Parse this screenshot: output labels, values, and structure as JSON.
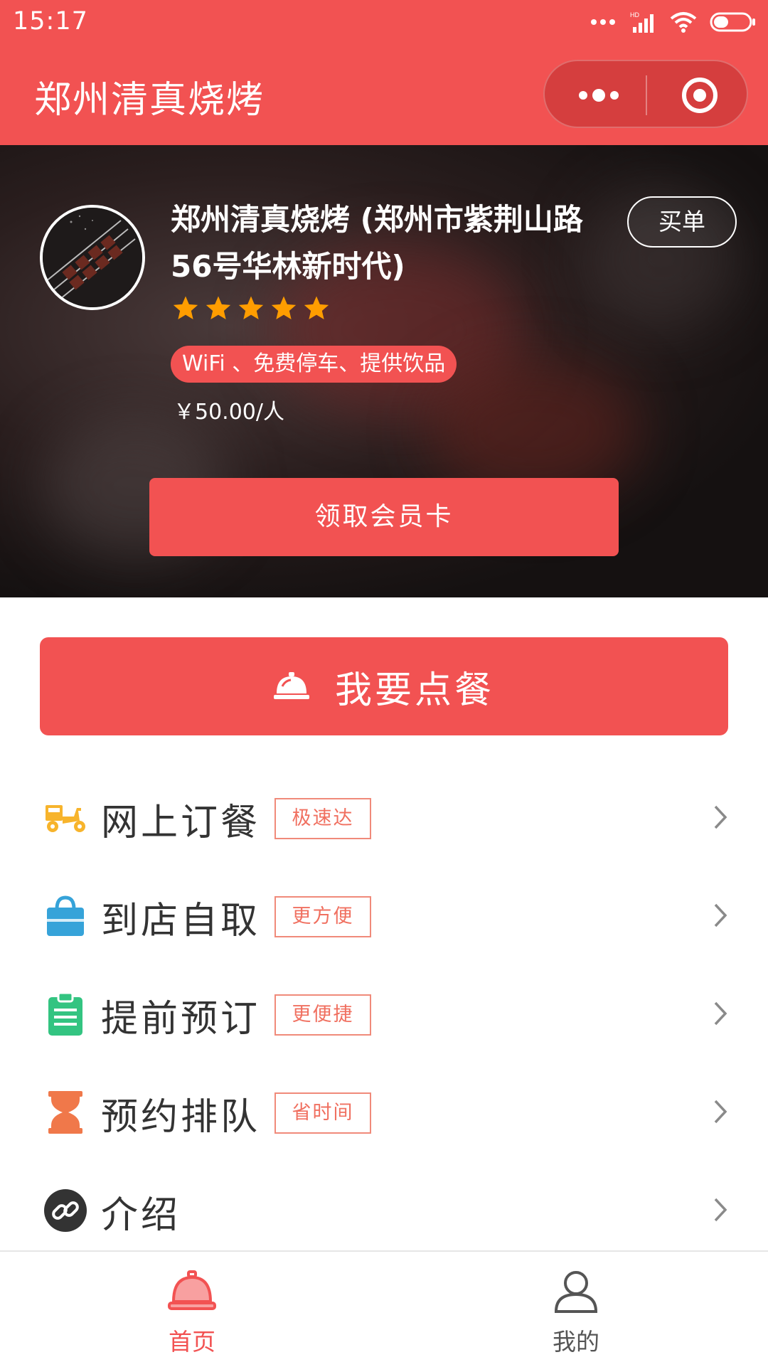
{
  "status_bar": {
    "time": "15:17"
  },
  "nav": {
    "title": "郑州清真烧烤"
  },
  "store": {
    "name": "郑州清真烧烤 (郑州市紫荆山路56号华林新时代)",
    "rating": 5,
    "amenities": "WiFi 、免费停车、提供饮品",
    "price": "￥50.00/人",
    "pay_label": "买单",
    "member_card_label": "领取会员卡"
  },
  "order": {
    "label": "我要点餐"
  },
  "menu": [
    {
      "label": "网上订餐",
      "tag": "极速达",
      "icon": "delivery-scooter-icon",
      "color": "#f7b42c"
    },
    {
      "label": "到店自取",
      "tag": "更方便",
      "icon": "shopping-bag-icon",
      "color": "#36a3d9"
    },
    {
      "label": "提前预订",
      "tag": "更便捷",
      "icon": "clipboard-icon",
      "color": "#33c481"
    },
    {
      "label": "预约排队",
      "tag": "省时间",
      "icon": "hourglass-icon",
      "color": "#f0784a"
    },
    {
      "label": "介绍",
      "tag": "",
      "icon": "link-icon",
      "color": "#333333"
    }
  ],
  "tabs": [
    {
      "label": "首页",
      "active": true,
      "icon": "food-cloche-icon"
    },
    {
      "label": "我的",
      "active": false,
      "icon": "user-icon"
    }
  ],
  "colors": {
    "accent": "#f25252",
    "tag_border": "#f08a7a",
    "tab_inactive": "#555555"
  }
}
